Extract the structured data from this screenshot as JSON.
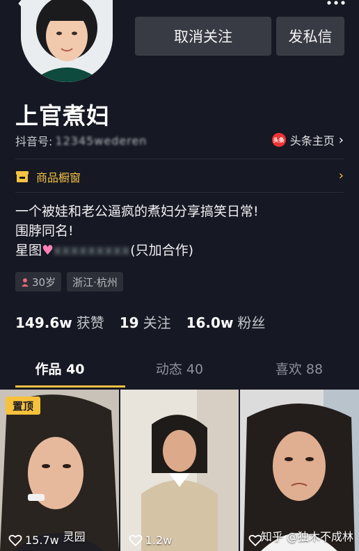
{
  "header": {
    "unfollow_label": "取消关注",
    "message_label": "发私信"
  },
  "profile": {
    "name": "上官煮妇",
    "id_label": "抖音号:",
    "id_value": "12345wederen",
    "toutiao_logo": "头条",
    "toutiao_label": "头条主页",
    "shop_label": "商品橱窗",
    "bio": [
      "一个被娃和老公逼疯的煮妇分享搞笑日常!",
      "围脖同名!"
    ],
    "bio_line3_prefix": "星图",
    "bio_line3_contact": "xxxxxxxxx",
    "bio_line3_suffix": "(只加合作)",
    "tags": {
      "age": "30岁",
      "location": "浙江·杭州"
    }
  },
  "stats": {
    "likes_num": "149.6w",
    "likes_label": "获赞",
    "following_num": "19",
    "following_label": "关注",
    "fans_num": "16.0w",
    "fans_label": "粉丝"
  },
  "tabs": [
    {
      "label": "作品 40",
      "active": true
    },
    {
      "label": "动态 40",
      "active": false
    },
    {
      "label": "喜欢 88",
      "active": false
    }
  ],
  "videos": [
    {
      "pinned_label": "置顶",
      "likes": "15.7w",
      "overlay_text": "灵园"
    },
    {
      "likes": "1.2w"
    },
    {
      "likes": "",
      "overlay_text": "知乎 @独木不成林"
    }
  ],
  "colors": {
    "background": "#161823",
    "accent_yellow": "#f5c242",
    "button_bg": "#393b44"
  }
}
